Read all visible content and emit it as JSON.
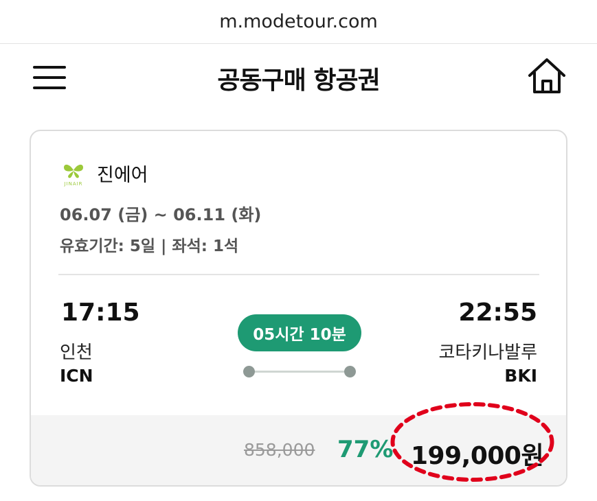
{
  "browser": {
    "url": "m.modetour.com"
  },
  "header": {
    "title": "공동구매 항공권"
  },
  "card": {
    "airline": {
      "name": "진에어",
      "logo_text": "JINAIR"
    },
    "dates": "06.07 (금) ~ 06.11 (화)",
    "validity": "유효기간: 5일 | 좌석: 1석",
    "departure": {
      "time": "17:15",
      "city": "인천",
      "code": "ICN"
    },
    "arrival": {
      "time": "22:55",
      "city": "코타키나발루",
      "code": "BKI"
    },
    "duration": "05시간 10분",
    "price": {
      "original": "858,000",
      "discount": "77%",
      "final": "199,000원"
    }
  },
  "colors": {
    "accent": "#1e9a73",
    "logo": "#9cc93a",
    "highlight": "#e0001b"
  }
}
